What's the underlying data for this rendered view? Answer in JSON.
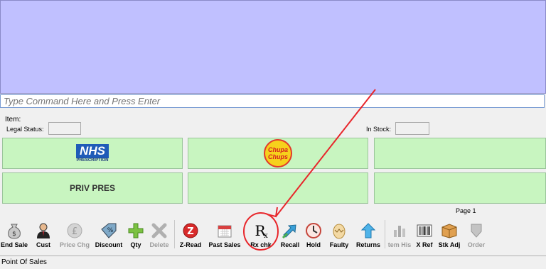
{
  "command": {
    "placeholder": "Type Command Here and Press Enter"
  },
  "item": {
    "label": "Item:",
    "legal_status_label": "Legal Status:",
    "in_stock_label": "In Stock:"
  },
  "tiles": {
    "nhs": "NHS",
    "nhs_sub": "PRESCRIPTION",
    "chupa_top": "Chupa",
    "chupa_bottom": "Chups",
    "priv_pres": "PRIV PRES"
  },
  "page_label": "Page 1",
  "toolbar": {
    "end_sale": "End Sale",
    "cust": "Cust",
    "price_chg": "Price Chg",
    "discount": "Discount",
    "qty": "Qty",
    "delete": "Delete",
    "z_read": "Z-Read",
    "past_sales": "Past Sales",
    "rx_chk": "Rx chk",
    "recall": "Recall",
    "hold": "Hold",
    "faulty": "Faulty",
    "returns": "Returns",
    "item_his": "tem His",
    "x_ref": "X Ref",
    "stk_adj": "Stk Adj",
    "order": "Order"
  },
  "status": {
    "text": "Point Of Sales"
  },
  "colors": {
    "display_bg": "#c0c0ff",
    "tile_bg": "#c8f5c0",
    "annotation": "#e8262b"
  }
}
